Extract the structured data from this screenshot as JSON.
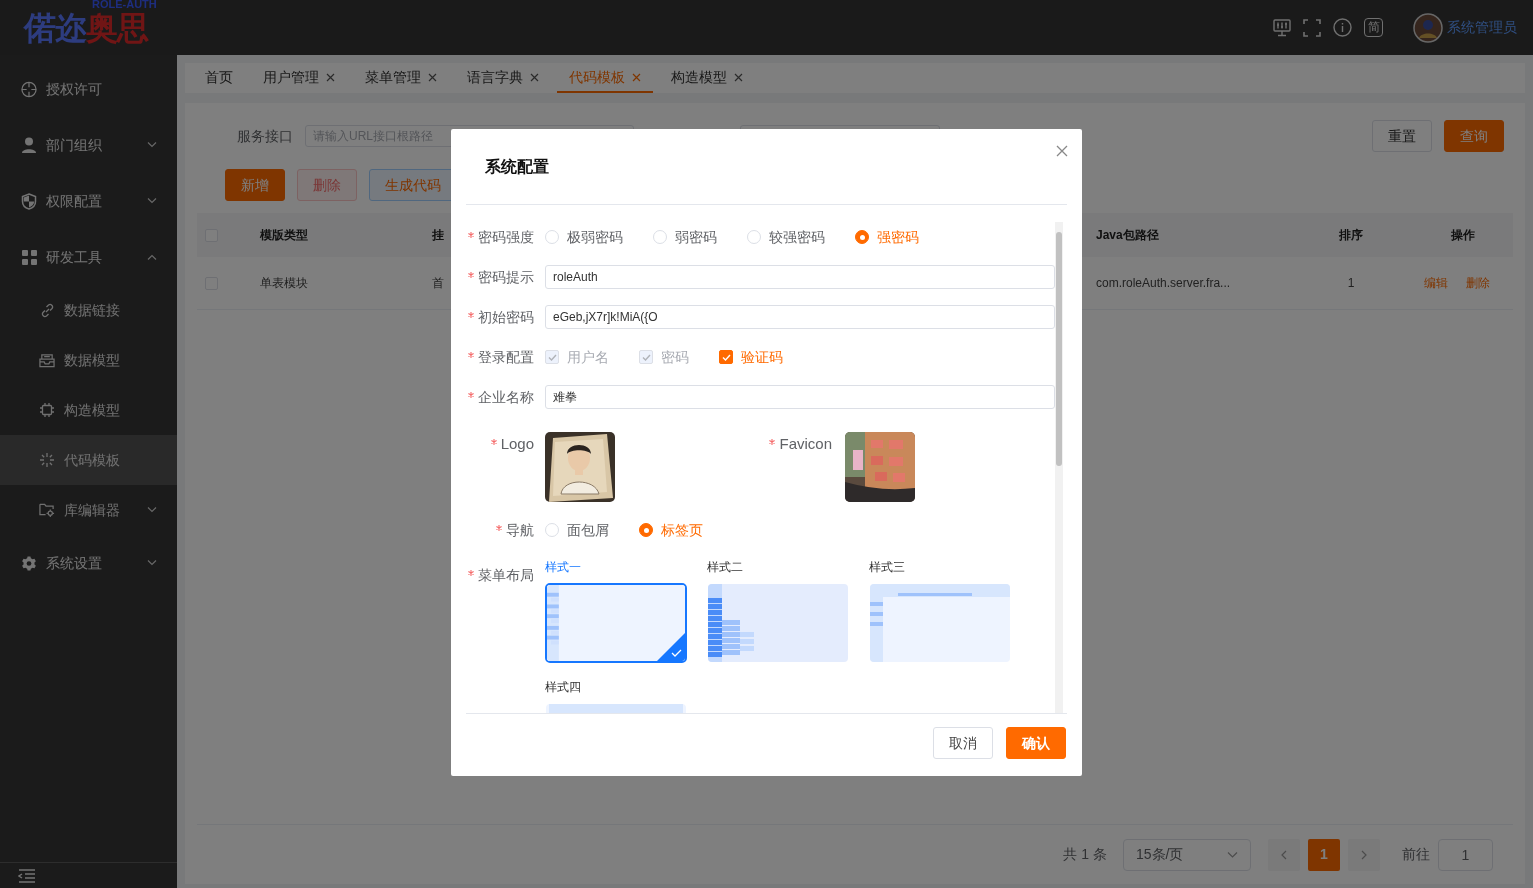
{
  "header": {
    "logo_caption": "ROLE-AUTH",
    "logo_text_first": "偌迩",
    "logo_text_second": "奥思",
    "language_toggle": "简",
    "user_name": "系统管理员"
  },
  "sidebar": {
    "items": [
      {
        "label": "授权许可",
        "selected": false
      },
      {
        "label": "部门组织",
        "selected": false,
        "expanded": false
      },
      {
        "label": "权限配置",
        "selected": false,
        "expanded": false
      },
      {
        "label": "研发工具",
        "selected": false,
        "expanded": true,
        "children": [
          {
            "label": "数据链接",
            "selected": false
          },
          {
            "label": "数据模型",
            "selected": false
          },
          {
            "label": "构造模型",
            "selected": false
          },
          {
            "label": "代码模板",
            "selected": true
          },
          {
            "label": "库编辑器",
            "selected": false,
            "expanded": false
          }
        ]
      },
      {
        "label": "系统设置",
        "selected": false,
        "expanded": false
      }
    ]
  },
  "tabs": [
    {
      "label": "首页",
      "closable": false,
      "selected": false
    },
    {
      "label": "用户管理",
      "closable": true,
      "selected": false
    },
    {
      "label": "菜单管理",
      "closable": true,
      "selected": false
    },
    {
      "label": "语言字典",
      "closable": true,
      "selected": false
    },
    {
      "label": "代码模板",
      "closable": true,
      "selected": true
    },
    {
      "label": "构造模型",
      "closable": true,
      "selected": false
    }
  ],
  "search": {
    "fields": [
      {
        "label": "服务接口",
        "placeholder": "请输入URL接口根路径"
      }
    ],
    "buttons": [
      {
        "label": "重置",
        "kind": "default"
      },
      {
        "label": "查询",
        "kind": "primary"
      }
    ]
  },
  "toolbar": [
    {
      "label": "新增",
      "kind": "primary"
    },
    {
      "label": "删除",
      "kind": "danger"
    },
    {
      "label": "生成代码",
      "kind": "info"
    }
  ],
  "table": {
    "header_checked": false,
    "columns": [
      "模版类型",
      "挂",
      "Java包路径",
      "排序",
      "操作"
    ],
    "rows": [
      {
        "checked": false,
        "cells": [
          "单表模块",
          "首",
          "com.roleAuth.server.fra...",
          "1"
        ],
        "actions": [
          "编辑",
          "删除"
        ]
      }
    ]
  },
  "pagination": {
    "total": "共 1 条",
    "page_size": "15条/页",
    "pages": [
      {
        "label": "1",
        "selected": true
      }
    ],
    "goto_label": "前往",
    "goto_value": "1"
  },
  "dialog": {
    "title": "系统配置",
    "fields": [
      {
        "kind": "radio",
        "label": "密码强度",
        "required": true,
        "options": [
          {
            "label": "极弱密码",
            "selected": false
          },
          {
            "label": "弱密码",
            "selected": false
          },
          {
            "label": "较强密码",
            "selected": false
          },
          {
            "label": "强密码",
            "selected": true
          }
        ]
      },
      {
        "kind": "input",
        "label": "密码提示",
        "required": true,
        "value": "roleAuth"
      },
      {
        "kind": "input",
        "label": "初始密码",
        "required": true,
        "value": "eGeb,jX7r]k!MiA({O"
      },
      {
        "kind": "checkbox",
        "label": "登录配置",
        "required": true,
        "options": [
          {
            "label": "用户名",
            "checked": true,
            "disabled": true
          },
          {
            "label": "密码",
            "checked": true,
            "disabled": true
          },
          {
            "label": "验证码",
            "checked": true,
            "disabled": false
          }
        ]
      },
      {
        "kind": "input",
        "label": "企业名称",
        "required": true,
        "value": "难拳"
      },
      {
        "kind": "images",
        "items": [
          {
            "label": "Logo",
            "required": true,
            "kind": "picture"
          },
          {
            "label": "Favicon",
            "required": true,
            "kind": "picture"
          }
        ]
      },
      {
        "kind": "radio",
        "label": "导航",
        "required": true,
        "options": [
          {
            "label": "面包屑",
            "selected": false
          },
          {
            "label": "标签页",
            "selected": true
          }
        ]
      },
      {
        "kind": "layout",
        "label": "菜单布局",
        "required": true,
        "options": [
          {
            "label": "样式一",
            "selected": true
          },
          {
            "label": "样式二",
            "selected": false
          },
          {
            "label": "样式三",
            "selected": false
          },
          {
            "label": "样式四",
            "selected": false
          }
        ]
      }
    ],
    "buttons": [
      {
        "label": "取消",
        "kind": "default"
      },
      {
        "label": "确认",
        "kind": "primary"
      }
    ]
  }
}
